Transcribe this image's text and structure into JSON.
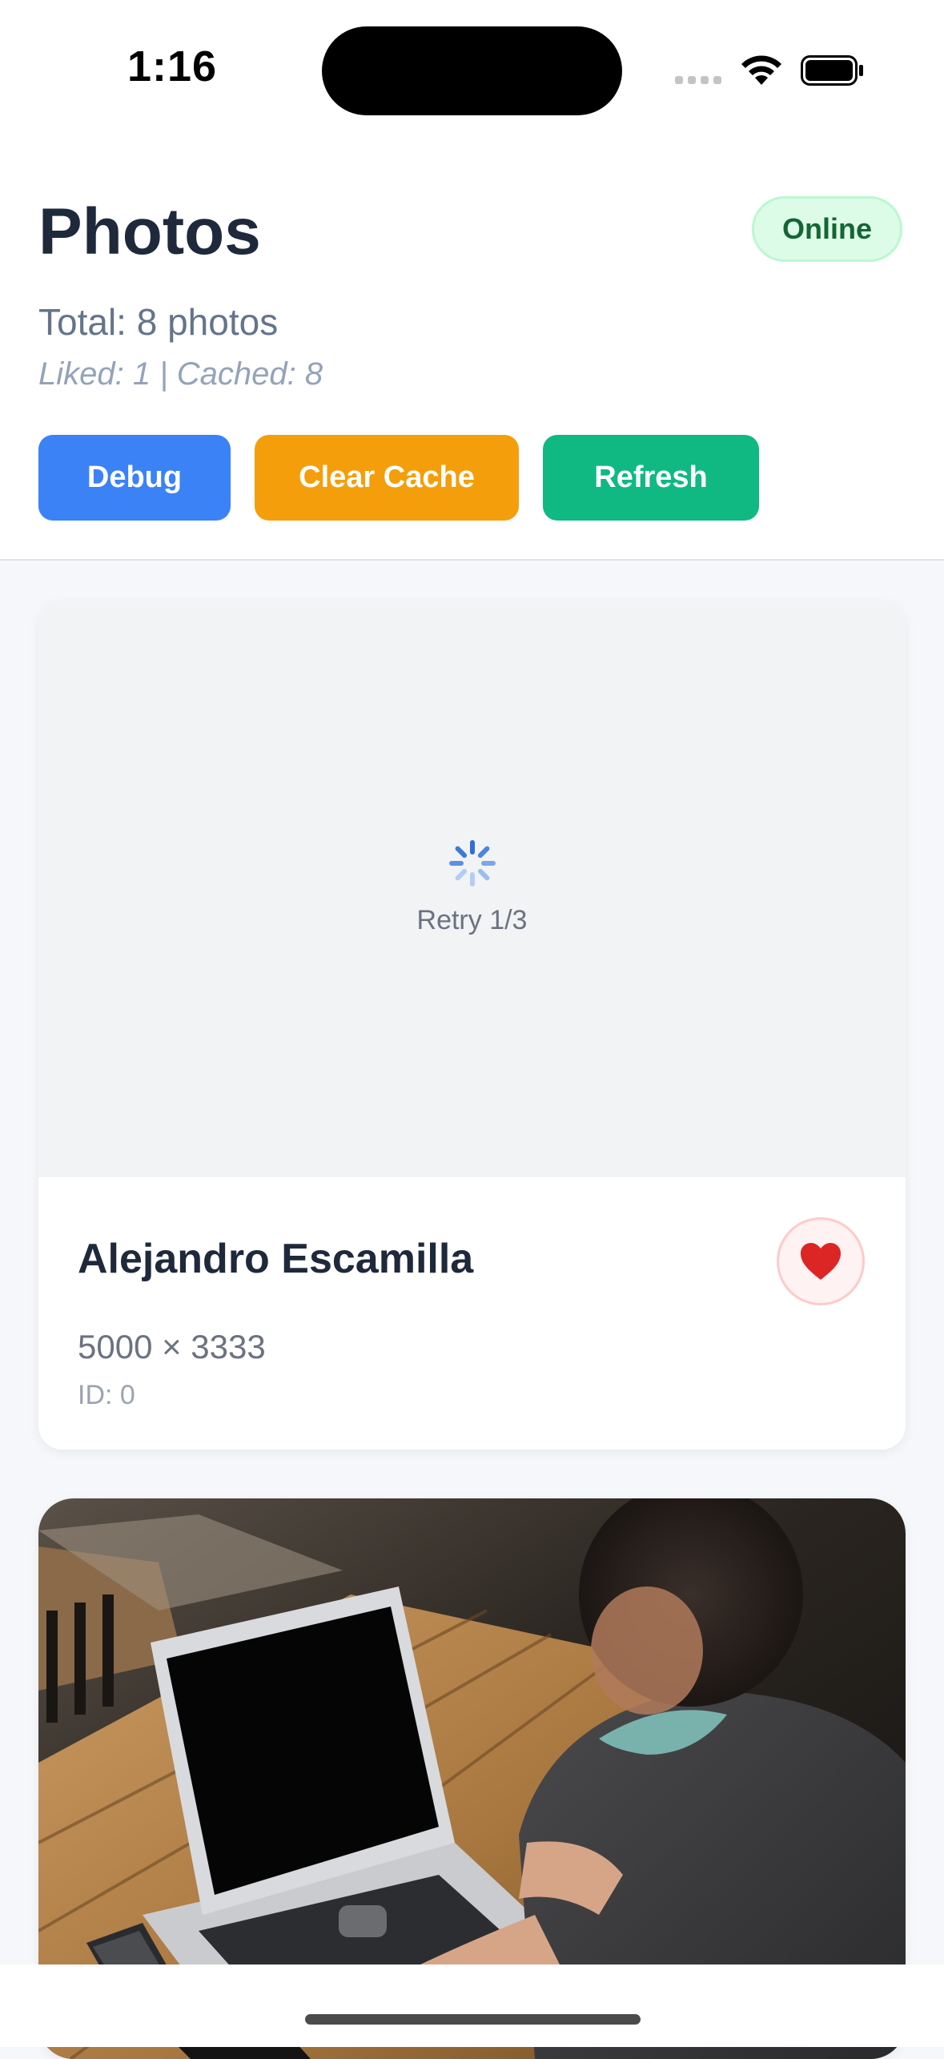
{
  "status_bar": {
    "time": "1:16"
  },
  "header": {
    "title": "Photos",
    "connection_status": "Online",
    "total_text": "Total: 8 photos",
    "stats_text": "Liked: 1 | Cached: 8",
    "buttons": {
      "debug": "Debug",
      "clear_cache": "Clear Cache",
      "refresh": "Refresh"
    }
  },
  "photos": [
    {
      "loading_text": "Retry 1/3",
      "author": "Alejandro Escamilla",
      "dimensions": "5000 × 3333",
      "id_text": "ID: 0",
      "liked": true
    },
    {
      "image_description": "person typing on a laptop at a wooden table"
    }
  ],
  "colors": {
    "debug_button": "#3b82f6",
    "clear_cache_button": "#f59e0b",
    "refresh_button": "#10b981",
    "online_badge_bg": "#dcfce7",
    "online_badge_text": "#166534",
    "heart": "#dc2626"
  },
  "icons": [
    "wifi-icon",
    "battery-icon",
    "spinner-icon",
    "heart-icon"
  ]
}
